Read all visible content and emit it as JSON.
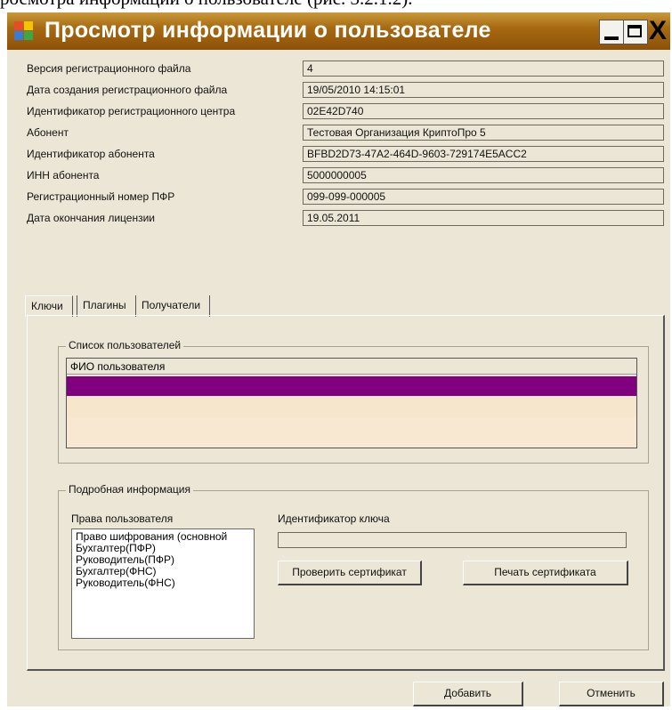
{
  "document": {
    "fragment": "росмотра информации о пользователе (рис. 3.2.1.2)."
  },
  "window": {
    "title": "Просмотр информации о пользователе",
    "controls": {
      "minimize": "_",
      "maximize": "□",
      "close": "X"
    }
  },
  "info_rows": [
    {
      "label": "Версия регистрационного файла",
      "value": "4"
    },
    {
      "label": "Дата создания регистрационного файла",
      "value": "19/05/2010 14:15:01"
    },
    {
      "label": "Идентификатор регистрационного центра",
      "value": "02E42D740"
    },
    {
      "label": "Абонент",
      "value": "Тестовая Организация КриптоПро 5"
    },
    {
      "label": "Идентификатор абонента",
      "value": "BFBD2D73-47A2-464D-9603-729174E5ACC2"
    },
    {
      "label": "ИНН абонента",
      "value": "5000000005"
    },
    {
      "label": "Регистрационный номер ПФР",
      "value": "099-099-000005"
    },
    {
      "label": "Дата окончания лицензии",
      "value": "19.05.2011"
    }
  ],
  "tabs": [
    {
      "label": "Ключи",
      "active": true
    },
    {
      "label": "Плагины",
      "active": false
    },
    {
      "label": "Получатели",
      "active": false
    }
  ],
  "users_group": {
    "legend": "Список пользователей",
    "column_header": "ФИО пользователя",
    "selected_color": "#800080"
  },
  "details_group": {
    "legend": "Подробная информация",
    "rights_label": "Права пользователя",
    "rights": [
      "Право шифрования (основной",
      "Бухгалтер(ПФР)",
      "Руководитель(ПФР)",
      "Бухгалтер(ФНС)",
      "Руководитель(ФНС)"
    ],
    "key_id_label": "Идентификатор ключа",
    "key_id_value": "",
    "check_cert_button": "Проверить сертификат",
    "print_cert_button": "Печать сертификата"
  },
  "footer": {
    "add_button": "Добавить",
    "cancel_button": "Отменить"
  },
  "colors": {
    "title_bar": "#a86a12",
    "window_bg": "#ece6d6",
    "selection": "#800080"
  }
}
